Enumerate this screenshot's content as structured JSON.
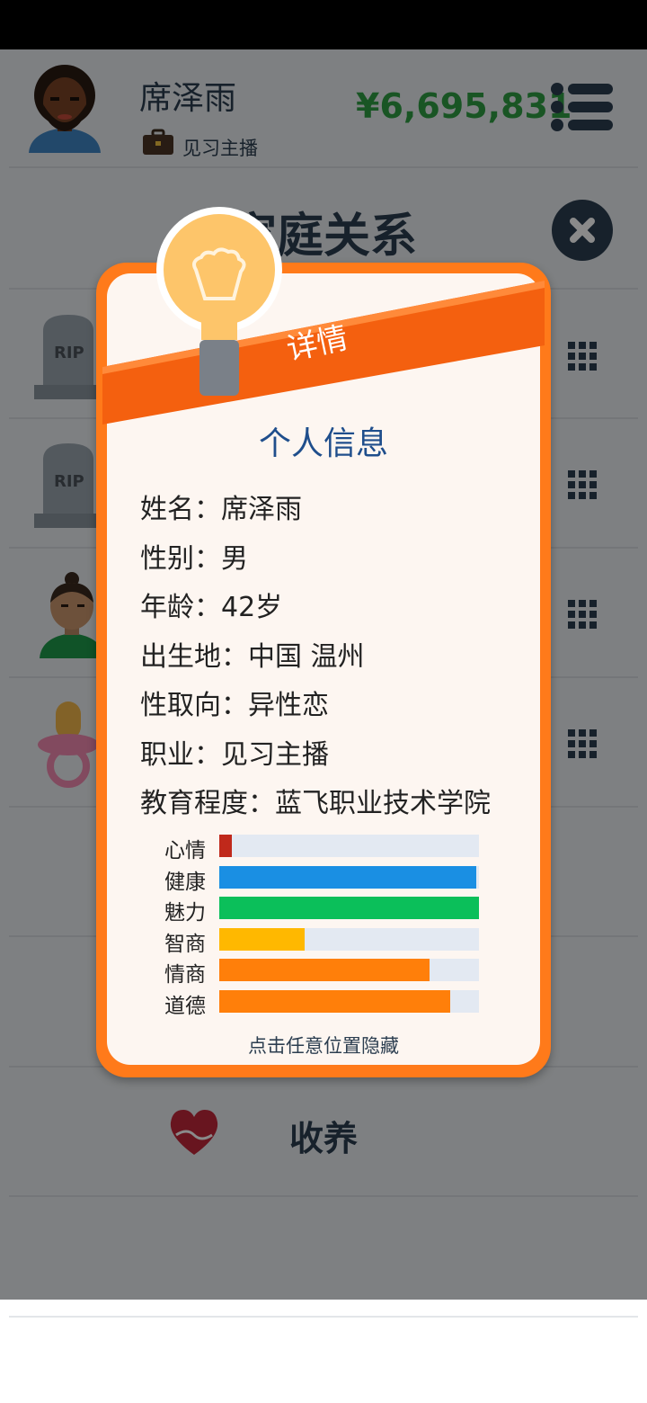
{
  "header": {
    "player_name": "席泽雨",
    "job": "见习主播",
    "money": "¥6,695,831"
  },
  "section": {
    "title": "家庭关系",
    "adopt_label": "收养"
  },
  "family_rows": [
    {
      "avatar": "tombstone-rip",
      "rip_text": "RIP"
    },
    {
      "avatar": "tombstone-rip",
      "rip_text": "RIP"
    },
    {
      "avatar": "man-with-topknot"
    },
    {
      "avatar": "baby-pacifier"
    }
  ],
  "modal": {
    "ribbon_label": "详情",
    "title": "个人信息",
    "info": {
      "name": "姓名：席泽雨",
      "gender": "性别：男",
      "age": "年龄：42岁",
      "birthplace": "出生地：中国 温州",
      "orientation": "性取向：异性恋",
      "job": "职业：见习主播",
      "education": "教育程度：蓝飞职业技术学院"
    },
    "stats": [
      {
        "label": "心情",
        "value": 0.05,
        "color": "#c0291b"
      },
      {
        "label": "健康",
        "value": 0.99,
        "color": "#1a8fe3"
      },
      {
        "label": "魅力",
        "value": 1.0,
        "color": "#0bbf5a"
      },
      {
        "label": "智商",
        "value": 0.33,
        "color": "#ffb800"
      },
      {
        "label": "情商",
        "value": 0.81,
        "color": "#ff7f0a"
      },
      {
        "label": "道德",
        "value": 0.89,
        "color": "#ff7f0a"
      }
    ],
    "hint": "点击任意位置隐藏"
  },
  "colors": {
    "money": "#2f9e44",
    "navy": "#2c3e50",
    "modal_border": "#ff7a1a",
    "title_blue": "#1f4e8c"
  }
}
